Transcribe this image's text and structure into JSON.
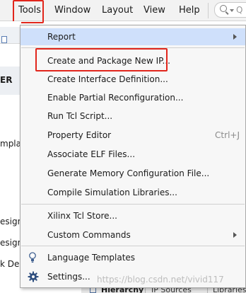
{
  "menubar": {
    "items": [
      {
        "label": "Tools",
        "underline": "T"
      },
      {
        "label": "Window",
        "underline": "W"
      },
      {
        "label": "Layout",
        "underline": "L"
      },
      {
        "label": "View",
        "underline": "V"
      },
      {
        "label": "Help",
        "underline": "H"
      }
    ],
    "search_hint": "Q"
  },
  "left_panel": {
    "texts": [
      "ER",
      "mplate",
      "esign",
      "esign",
      "k Des"
    ]
  },
  "tools_menu": {
    "items": [
      {
        "label": "Report",
        "submenu": true,
        "highlighted": true
      },
      {
        "label": "Create and Package New IP..."
      },
      {
        "label": "Create Interface Definition..."
      },
      {
        "label": "Enable Partial Reconfiguration..."
      },
      {
        "label": "Run Tcl Script..."
      },
      {
        "label": "Property Editor",
        "accelerator": "Ctrl+J"
      },
      {
        "label": "Associate ELF Files..."
      },
      {
        "label": "Generate Memory Configuration File..."
      },
      {
        "label": "Compile Simulation Libraries..."
      },
      {
        "label": "Xilinx Tcl Store..."
      },
      {
        "label": "Custom Commands",
        "submenu": true
      },
      {
        "label": "Language Templates",
        "icon": "lightbulb-icon"
      },
      {
        "label": "Settings...",
        "icon": "gear-icon"
      }
    ]
  },
  "bottom_tabs": [
    "Hierarchy",
    "IP Sources",
    "Libraries"
  ],
  "watermark": "https://blog.csdn.net/vivid117",
  "colors": {
    "highlight_box": "#e1261c",
    "hover_row": "#cfe0fb",
    "menu_bg": "#f7f7f7"
  }
}
